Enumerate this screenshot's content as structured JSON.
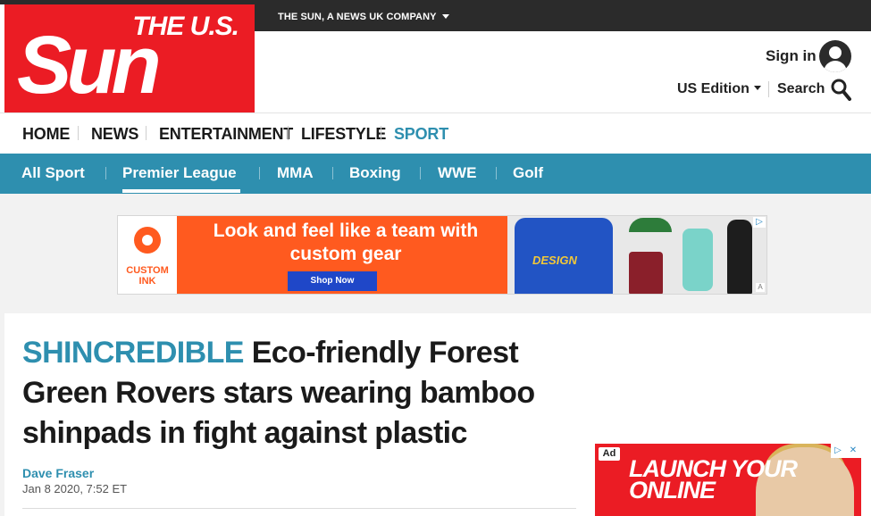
{
  "header": {
    "logo_top": "THE U.S.",
    "logo_main": "Sun",
    "company_label": "THE SUN, A NEWS UK COMPANY",
    "sign_in_label": "Sign in",
    "edition_label": "US Edition",
    "search_label": "Search"
  },
  "main_nav": {
    "items": [
      {
        "label": "HOME"
      },
      {
        "label": "NEWS"
      },
      {
        "label": "ENTERTAINMENT"
      },
      {
        "label": "LIFESTYLE"
      },
      {
        "label": "SPORT",
        "active": true
      }
    ]
  },
  "sport_nav": {
    "items": [
      {
        "label": "All Sport"
      },
      {
        "label": "Premier League",
        "active": true
      },
      {
        "label": "MMA"
      },
      {
        "label": "Boxing"
      },
      {
        "label": "WWE"
      },
      {
        "label": "Golf"
      }
    ]
  },
  "top_ad": {
    "brand": "CUSTOM INK",
    "headline": "Look and  feel like a team with custom gear",
    "button_label": "Shop Now",
    "shirt_text": "DESIGN"
  },
  "article": {
    "kicker": "SHINCREDIBLE",
    "headline": "Eco-friendly Forest Green Rovers stars wearing bamboo shinpads in fight against plastic",
    "author": "Dave Fraser",
    "date": "Jan 8 2020, 7:52 ET"
  },
  "side_ad": {
    "badge": "Ad",
    "text": "LAUNCH YOUR ONLINE"
  },
  "colors": {
    "brand_red": "#eb1c24",
    "sport_blue": "#2e8faf",
    "dark_bar": "#2b2b2b"
  }
}
